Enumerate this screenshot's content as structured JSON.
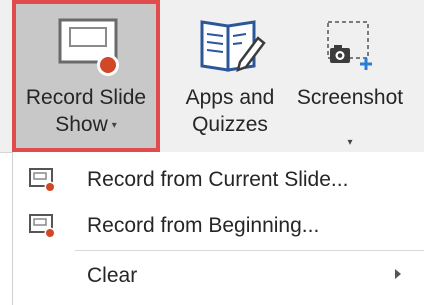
{
  "ribbon": {
    "record_slide_show": {
      "line1": "Record Slide",
      "line2": "Show",
      "caret": "▾"
    },
    "apps_and_quizzes": {
      "line1": "Apps and",
      "line2": "Quizzes"
    },
    "screenshot": {
      "line1": "Screenshot",
      "caret": "▾"
    }
  },
  "menu": {
    "items": [
      {
        "label": "Record from Current Slide...",
        "icon": "record-slide-icon"
      },
      {
        "label": "Record from Beginning...",
        "icon": "record-slide-icon"
      },
      {
        "label": "Clear",
        "icon": "",
        "has_submenu": true
      }
    ]
  },
  "colors": {
    "highlight_border": "#e14b4b",
    "record_dot": "#d24726",
    "apps_icon": "#2b579a"
  }
}
